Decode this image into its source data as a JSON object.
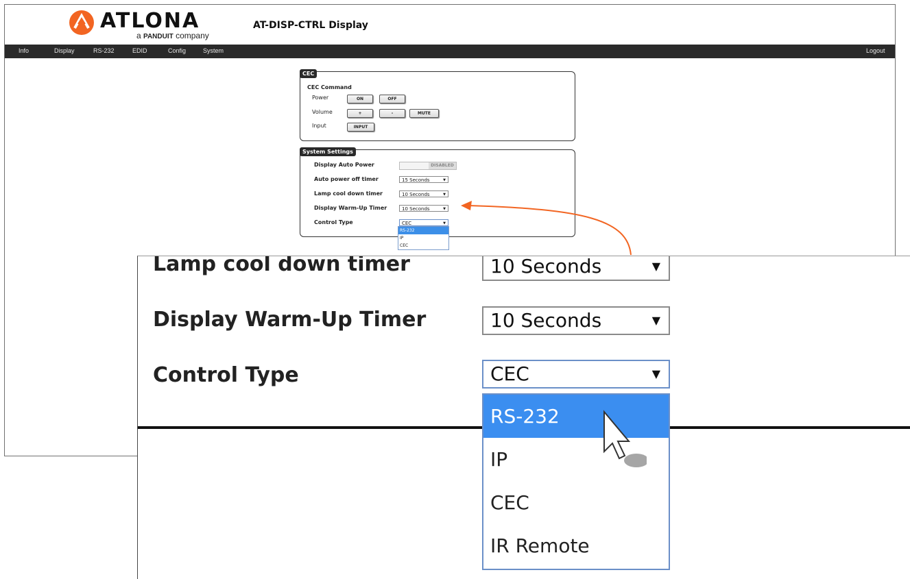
{
  "brand": {
    "name": "ATLONA",
    "tagline_prefix": "a",
    "tagline_brand": "PANDUIT",
    "tagline_suffix": "company"
  },
  "header": {
    "title": "AT-DISP-CTRL  Display"
  },
  "nav": {
    "items": [
      "Info",
      "Display",
      "RS-232",
      "EDID",
      "Config",
      "System"
    ],
    "logout": "Logout"
  },
  "cec": {
    "legend": "CEC",
    "heading": "CEC Command",
    "power_label": "Power",
    "power_on": "ON",
    "power_off": "OFF",
    "volume_label": "Volume",
    "vol_up": "+",
    "vol_down": "-",
    "mute": "MUTE",
    "input_label": "Input",
    "input_btn": "INPUT"
  },
  "system": {
    "legend": "System Settings",
    "auto_power_label": "Display Auto Power",
    "auto_power_state": "DISABLED",
    "auto_off_label": "Auto power off timer",
    "auto_off_value": "15 Seconds",
    "lamp_label": "Lamp cool down timer",
    "lamp_value": "10 Seconds",
    "warmup_label": "Display Warm-Up Timer",
    "warmup_value": "10 Seconds",
    "control_label": "Control Type",
    "control_value": "CEC",
    "options": [
      "RS-232",
      "IP",
      "CEC"
    ]
  },
  "zoom": {
    "lamp_label": "Lamp cool down timer",
    "lamp_value": "10 Seconds",
    "warmup_label": "Display Warm-Up Timer",
    "warmup_value": "10 Seconds",
    "control_label": "Control Type",
    "control_value": "CEC",
    "options": [
      "RS-232",
      "IP",
      "CEC",
      "IR Remote"
    ]
  },
  "colors": {
    "accent": "#f26522",
    "highlight": "#3b8ef0",
    "navbar": "#2a2a2a"
  }
}
